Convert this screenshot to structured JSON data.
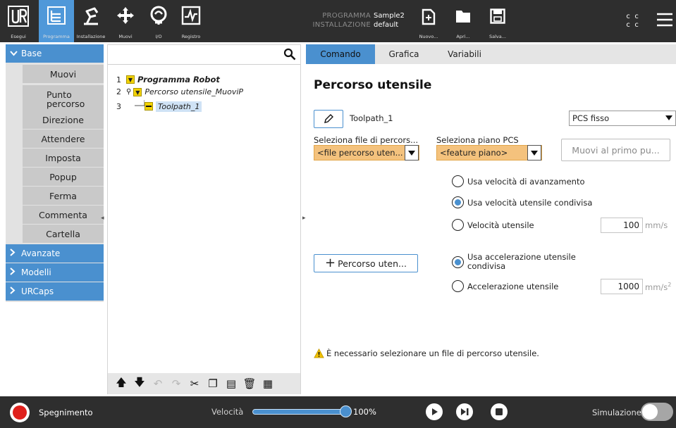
{
  "topbar": {
    "nav": [
      {
        "label": "Esegui",
        "icon": "ur-logo-icon"
      },
      {
        "label": "Programma",
        "icon": "program-tree-icon",
        "active": true
      },
      {
        "label": "Installazione",
        "icon": "robot-arm-icon"
      },
      {
        "label": "Muovi",
        "icon": "move-arrows-icon"
      },
      {
        "label": "I/O",
        "icon": "io-icon"
      },
      {
        "label": "Registro",
        "icon": "log-chart-icon"
      }
    ],
    "programma_key": "PROGRAMMA",
    "programma_value": "Sample2",
    "installazione_key": "INSTALLAZIONE",
    "installazione_value": "default",
    "file_buttons": [
      {
        "label": "Nuovo...",
        "icon": "new-file-icon"
      },
      {
        "label": "Apri...",
        "icon": "folder-icon"
      },
      {
        "label": "Salva...",
        "icon": "save-icon"
      }
    ],
    "cc_line1": "c c",
    "cc_line2": "c c",
    "menu_icon": "hamburger-menu-icon"
  },
  "sidebar": {
    "base_label": "Base",
    "items": [
      "Muovi",
      "Punto percorso",
      "Direzione",
      "Attendere",
      "Imposta",
      "Popup",
      "Ferma",
      "Commenta",
      "Cartella"
    ],
    "categories": [
      "Avanzate",
      "Modelli",
      "URCaps"
    ]
  },
  "tree": {
    "search_value": "",
    "rows": [
      {
        "num": "1",
        "label": "Programma Robot"
      },
      {
        "num": "2",
        "label": "Percorso utensile_MuoviP"
      },
      {
        "num": "3",
        "label": "Toolpath_1"
      }
    ]
  },
  "right": {
    "tabs": [
      "Comando",
      "Grafica",
      "Variabili"
    ],
    "title": "Percorso utensile",
    "toolpath_name": "Toolpath_1",
    "feature_select": "PCS fisso",
    "file_label": "Seleziona file di percors...",
    "file_value": "<file percorso uten...",
    "plane_label": "Seleziona piano PCS",
    "plane_value": "<feature piano>",
    "move_first_button": "Muovi al primo pu...",
    "speed_options": [
      {
        "label": "Usa velocità di avanzamento",
        "selected": false
      },
      {
        "label": "Usa velocità utensile condivisa",
        "selected": true
      },
      {
        "label": "Velocità utensile",
        "selected": false
      }
    ],
    "tool_speed_value": "100",
    "tool_speed_unit": "mm/s",
    "add_button": "Percorso uten...",
    "accel_options": [
      {
        "label": "Usa accelerazione utensile condivisa",
        "selected": true
      },
      {
        "label": "Accelerazione utensile",
        "selected": false
      }
    ],
    "tool_accel_value": "1000",
    "tool_accel_unit": "mm/s",
    "tool_accel_unit_sup": "2",
    "warning": "È necessario selezionare un file di percorso utensile."
  },
  "bottombar": {
    "power_label": "Spegnimento",
    "speed_label": "Velocità",
    "speed_value": "100%",
    "speed_fraction": 1.0,
    "sim_label": "Simulazione",
    "sim_on": false
  },
  "colors": {
    "accent": "#4a90cf",
    "topbar": "#2e2e2e",
    "warning_fill": "#f4c27d",
    "tree_yellow": "#f2d200",
    "power_red": "#e0201c"
  }
}
